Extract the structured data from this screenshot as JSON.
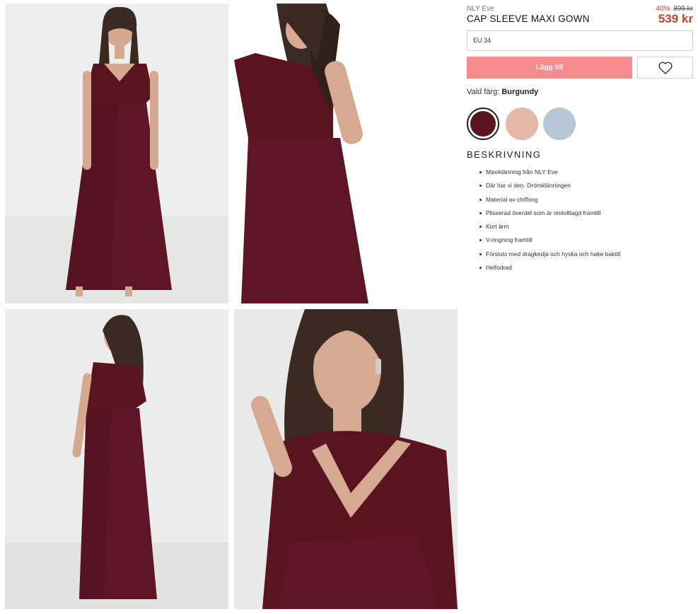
{
  "product": {
    "brand": "NLY Eve",
    "title": "CAP SLEEVE MAXI GOWN",
    "discount": "40%",
    "old_price": "899 kr",
    "price": "539 kr"
  },
  "size_select": {
    "value": "EU 34"
  },
  "actions": {
    "add_to_cart_label": "Lägg till",
    "wishlist_icon": "heart-icon"
  },
  "color": {
    "label": "Vald färg:",
    "selected": "Burgundy",
    "swatches": [
      {
        "name": "burgundy",
        "hex": "#5a1420"
      },
      {
        "name": "pink",
        "hex": "#e4b7a6"
      },
      {
        "name": "light-blue",
        "hex": "#b7c6d6"
      }
    ]
  },
  "description": {
    "heading": "BESKRIVNING",
    "items": [
      "Maxiklänning från NLY Eve",
      "Där har vi den. Drömklänningen",
      "Material av chiffong",
      "Plisserad överdel som är omlottlagd framtill",
      "Kort ärm",
      "V-ringning framtill",
      "Försluts med dragkedja och hyska och hake baktill",
      "Helfodrad"
    ]
  },
  "gallery": {
    "images": [
      "model-front-full",
      "model-back-upper",
      "model-back-full",
      "model-closeup"
    ]
  }
}
